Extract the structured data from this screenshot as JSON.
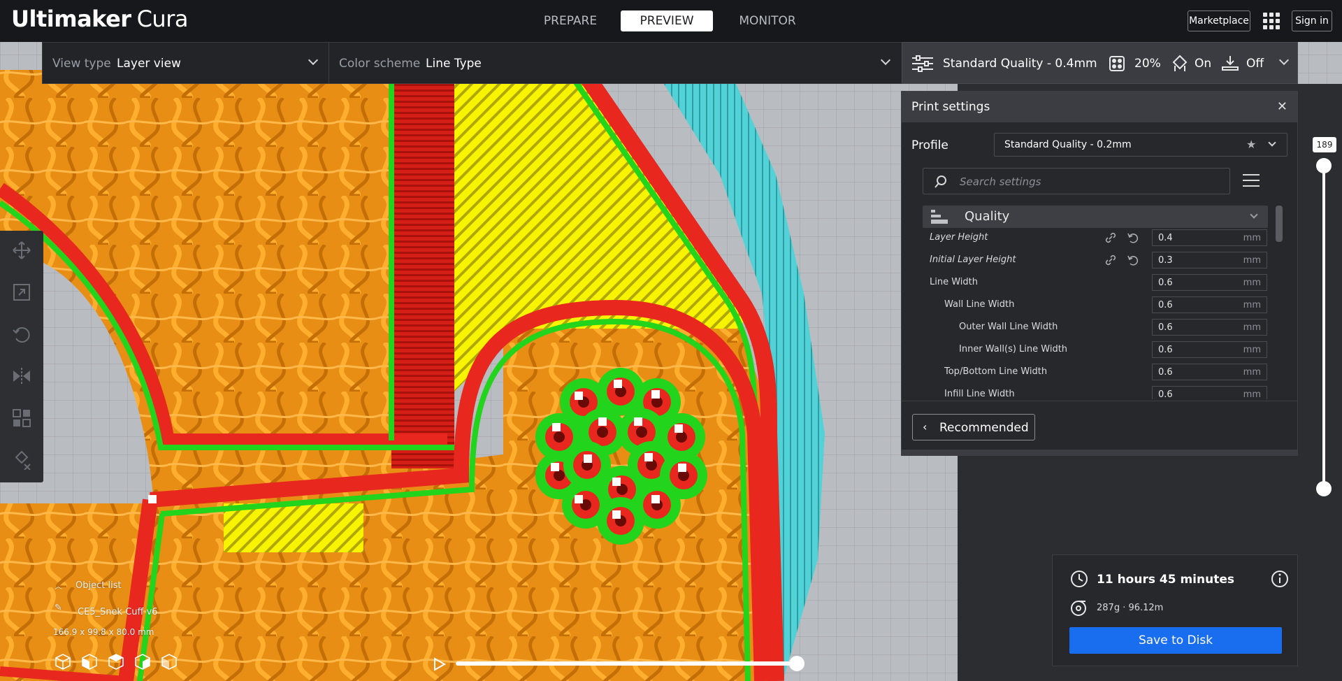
{
  "app": {
    "brand_bold": "Ultimaker",
    "brand_light": "Cura"
  },
  "stages": [
    {
      "label": "PREPARE",
      "active": false
    },
    {
      "label": "PREVIEW",
      "active": true
    },
    {
      "label": "MONITOR",
      "active": false
    }
  ],
  "header": {
    "marketplace": "Marketplace",
    "sign_in": "Sign in"
  },
  "view": {
    "view_type_label": "View type",
    "view_type_value": "Layer view",
    "color_scheme_label": "Color scheme",
    "color_scheme_value": "Line Type"
  },
  "print_summary": {
    "profile": "Standard Quality - 0.4mm",
    "infill": "20%",
    "support": "On",
    "adhesion": "Off"
  },
  "print_settings": {
    "title": "Print settings",
    "profile_label": "Profile",
    "profile_value": "Standard Quality - 0.2mm",
    "search_placeholder": "Search settings",
    "category": "Quality",
    "settings": [
      {
        "label": "Layer Height",
        "value": "0.4",
        "unit": "mm",
        "changed": true
      },
      {
        "label": "Initial Layer Height",
        "value": "0.3",
        "unit": "mm",
        "changed": true
      },
      {
        "label": "Line Width",
        "value": "0.6",
        "unit": "mm",
        "changed": false
      },
      {
        "label": "Wall Line Width",
        "value": "0.6",
        "unit": "mm",
        "changed": false
      },
      {
        "label": "Outer Wall Line Width",
        "value": "0.6",
        "unit": "mm",
        "changed": false
      },
      {
        "label": "Inner Wall(s) Line Width",
        "value": "0.6",
        "unit": "mm",
        "changed": false
      },
      {
        "label": "Top/Bottom Line Width",
        "value": "0.6",
        "unit": "mm",
        "changed": false
      },
      {
        "label": "Infill Line Width",
        "value": "0.6",
        "unit": "mm",
        "changed": false
      }
    ],
    "recommended_button": "Recommended"
  },
  "layer_slider": {
    "current_layer": "189"
  },
  "output": {
    "print_time": "11 hours 45 minutes",
    "material": "287g · 96.12m",
    "save_button": "Save to Disk"
  },
  "object_list": {
    "title": "Object list",
    "object_name": "CE5_Snek Cuff v6",
    "dimensions": "166.9 x 99.8 x 80.0 mm"
  },
  "colors": {
    "accent_blue": "#196ef0",
    "infill_orange": "#f5a623",
    "wall_red": "#e8281e",
    "inner_wall_green": "#22d41c",
    "skin_yellow": "#f8f400",
    "support_cyan": "#4ecfd2"
  }
}
